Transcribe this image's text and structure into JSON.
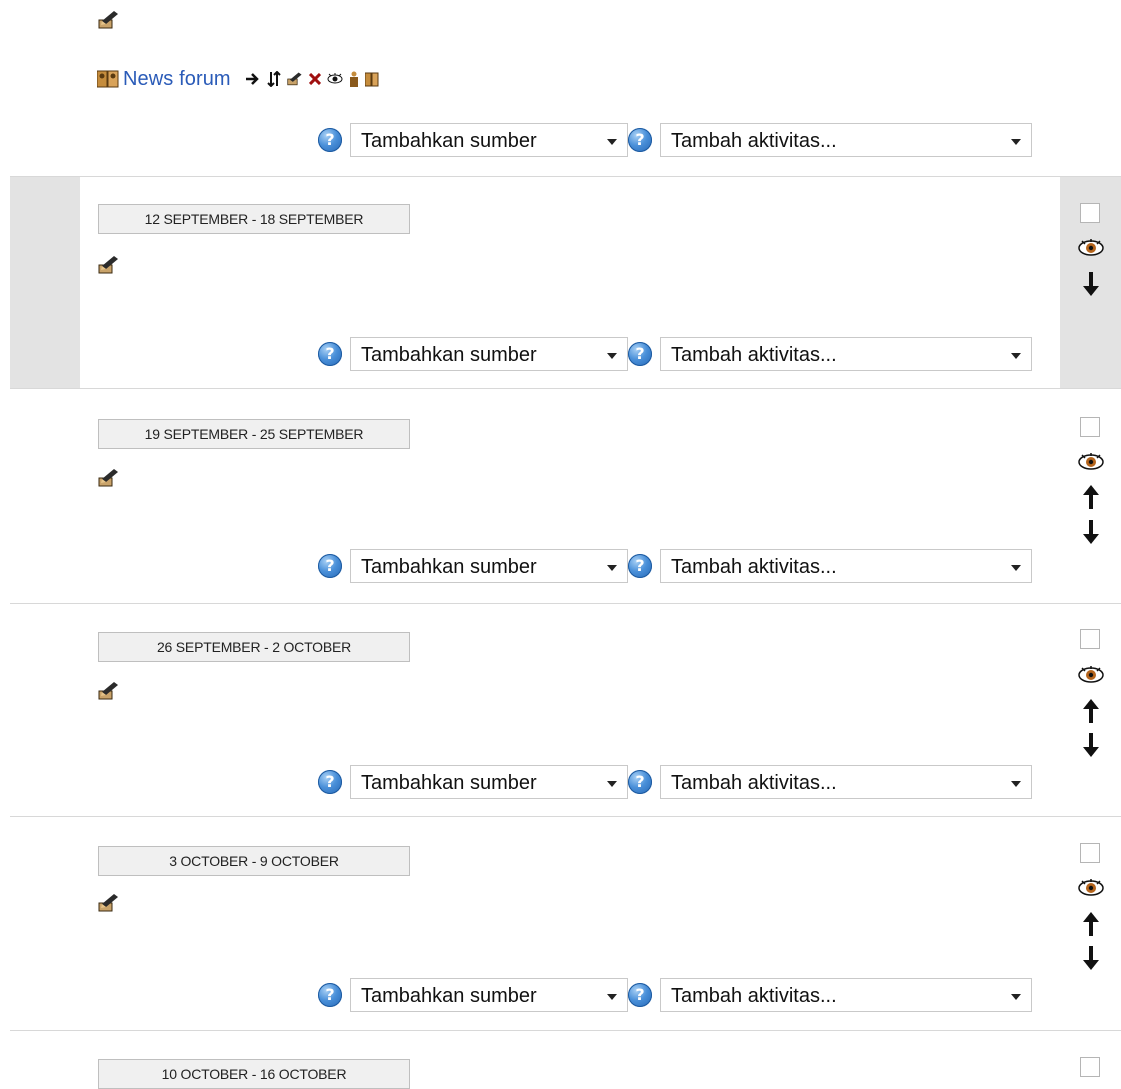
{
  "topic0": {
    "forum": {
      "label": "News forum"
    }
  },
  "add_controls": {
    "help_glyph": "?",
    "resource_placeholder": "Tambahkan sumber",
    "activity_placeholder": "Tambah aktivitas..."
  },
  "weeks": [
    {
      "label": "12 SEPTEMBER - 18 SEPTEMBER"
    },
    {
      "label": "19 SEPTEMBER - 25 SEPTEMBER"
    },
    {
      "label": "26 SEPTEMBER - 2 OCTOBER"
    },
    {
      "label": "3 OCTOBER - 9 OCTOBER"
    },
    {
      "label": "10 OCTOBER - 16 OCTOBER"
    }
  ],
  "colors": {
    "link": "#2a5bb8",
    "current_week_band": "#e3e3e3",
    "help_icon": "#4a90d9",
    "delete_icon": "#a01010",
    "eye_icon": "#b5651d"
  },
  "icons": {
    "edit": "pencil-icon",
    "forum": "forum-icon",
    "move_right": "move-right-icon",
    "move": "move-icon",
    "delete": "delete-icon",
    "visibility": "eye-icon",
    "group_mode": "group-icon",
    "roles": "roles-icon",
    "help": "help-icon",
    "highlight": "highlight-checkbox-icon",
    "move_up": "arrow-up-icon",
    "move_down": "arrow-down-icon"
  }
}
